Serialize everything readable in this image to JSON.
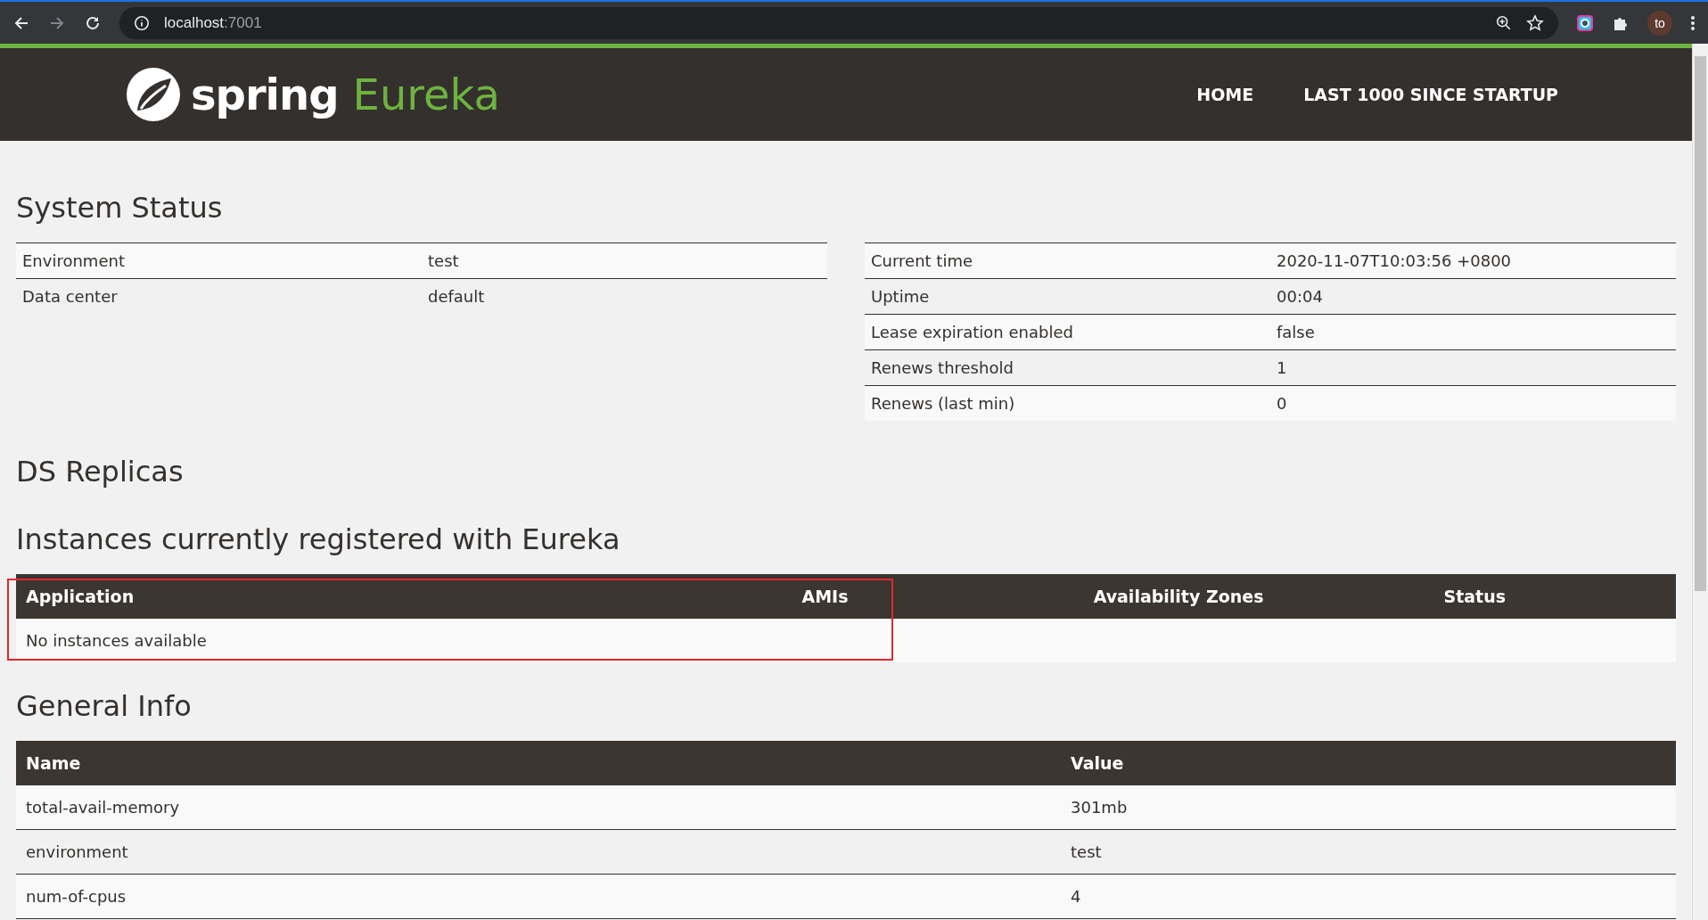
{
  "browser": {
    "url_host": "localhost",
    "url_port": ":7001",
    "profile_initials": "to"
  },
  "header": {
    "logo_word": "spring",
    "logo_product": "Eureka",
    "nav": [
      {
        "label": "HOME"
      },
      {
        "label": "LAST 1000 SINCE STARTUP"
      }
    ]
  },
  "system_status": {
    "title": "System Status",
    "left_rows": [
      {
        "name": "Environment",
        "value": "test"
      },
      {
        "name": "Data center",
        "value": "default"
      }
    ],
    "right_rows": [
      {
        "name": "Current time",
        "value": "2020-11-07T10:03:56 +0800"
      },
      {
        "name": "Uptime",
        "value": "00:04"
      },
      {
        "name": "Lease expiration enabled",
        "value": "false"
      },
      {
        "name": "Renews threshold",
        "value": "1"
      },
      {
        "name": "Renews (last min)",
        "value": "0"
      }
    ]
  },
  "ds_replicas": {
    "title": "DS Replicas"
  },
  "instances": {
    "title": "Instances currently registered with Eureka",
    "columns": [
      "Application",
      "AMIs",
      "Availability Zones",
      "Status"
    ],
    "empty_message": "No instances available",
    "highlighted": true
  },
  "general_info": {
    "title": "General Info",
    "columns": [
      "Name",
      "Value"
    ],
    "rows": [
      {
        "name": "total-avail-memory",
        "value": "301mb"
      },
      {
        "name": "environment",
        "value": "test"
      },
      {
        "name": "num-of-cpus",
        "value": "4"
      }
    ]
  }
}
